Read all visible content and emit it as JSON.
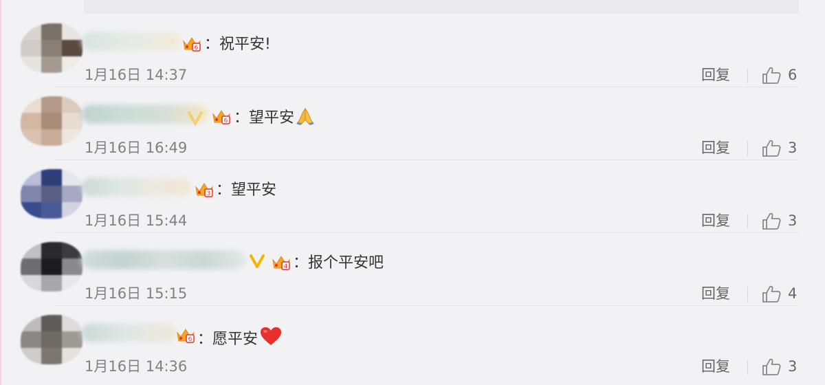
{
  "comments": [
    {
      "text": "：祝平安!",
      "emoji": "",
      "time": "1月16日 14:37",
      "reply": "回复",
      "likes": "6",
      "badge_level": "6"
    },
    {
      "text": "：望平安",
      "emoji": "folded-hands",
      "time": "1月16日 16:49",
      "reply": "回复",
      "likes": "3",
      "badge_level": "6"
    },
    {
      "text": "：望平安",
      "emoji": "",
      "time": "1月16日 15:44",
      "reply": "回复",
      "likes": "3",
      "badge_level": "3"
    },
    {
      "text": "：报个平安吧",
      "emoji": "",
      "time": "1月16日 15:15",
      "reply": "回复",
      "likes": "4",
      "badge_level": "4"
    },
    {
      "text": "：愿平安",
      "emoji": "red-heart",
      "time": "1月16日 14:36",
      "reply": "回复",
      "likes": "3",
      "badge_level": "6"
    }
  ],
  "colors": {
    "background": "#f2f2f5",
    "text": "#333333",
    "muted": "#808080",
    "crown": "#f5a623",
    "heart": "#e8302a"
  }
}
